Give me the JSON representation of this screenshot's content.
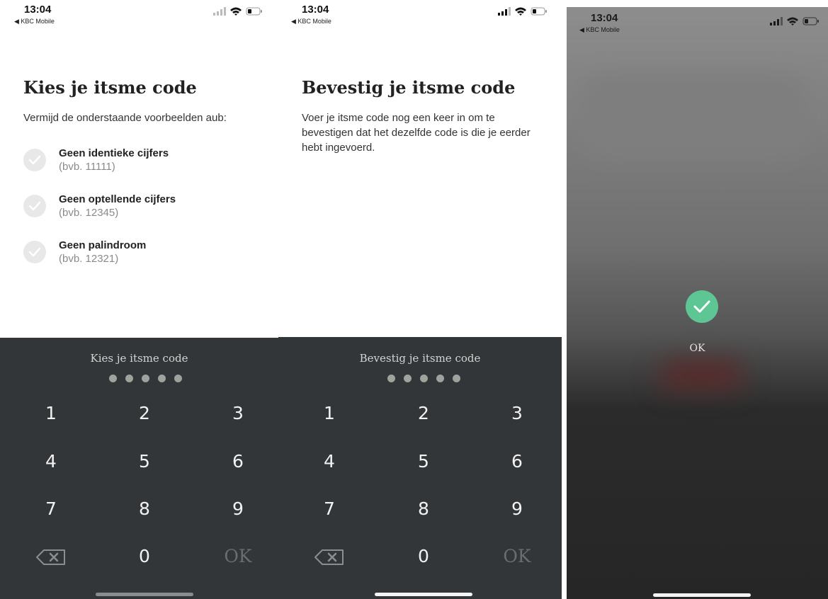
{
  "status": {
    "time": "13:04",
    "back_label": "◀ KBC Mobile"
  },
  "choose": {
    "title": "Kies je itsme code",
    "subtitle": "Vermijd de onderstaande voorbeelden aub:",
    "rules": [
      {
        "title": "Geen identieke cijfers",
        "example": "(bvb. 11111)"
      },
      {
        "title": "Geen optellende cijfers",
        "example": "(bvb. 12345)"
      },
      {
        "title": "Geen palindroom",
        "example": "(bvb. 12321)"
      }
    ],
    "keypad_title": "Kies je itsme code"
  },
  "confirm": {
    "title": "Bevestig je itsme code",
    "subtitle": "Voer je itsme code nog een keer in om te bevestigen dat het dezelfde code is die je eerder hebt ingevoerd.",
    "keypad_title": "Bevestig je itsme code"
  },
  "keypad": {
    "keys": [
      "1",
      "2",
      "3",
      "4",
      "5",
      "6",
      "7",
      "8",
      "9",
      "0"
    ],
    "ok_label": "OK"
  },
  "success": {
    "label": "OK"
  },
  "colors": {
    "keypad_bg": "#333638",
    "success_green": "#5ec595",
    "dot": "#9ea49d"
  }
}
